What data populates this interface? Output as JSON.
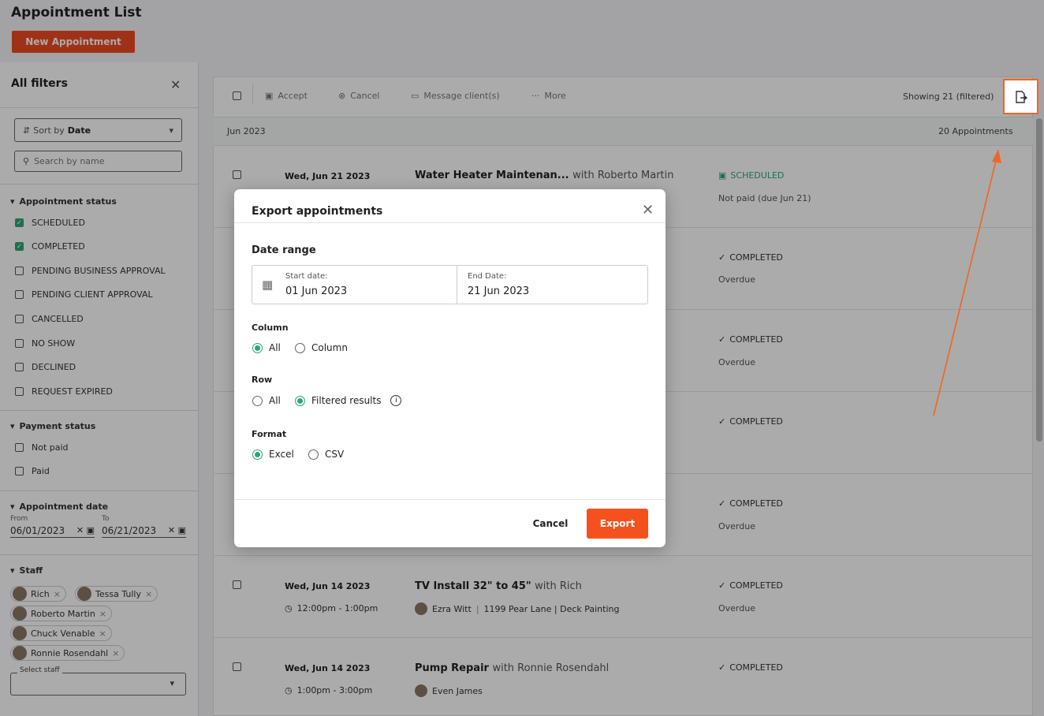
{
  "header": {
    "title": "Appointment List",
    "new_button": "New Appointment"
  },
  "sidebar": {
    "title": "All filters",
    "sort": {
      "prefix": "Sort by",
      "value": "Date"
    },
    "search_placeholder": "Search by name",
    "appointment_status": {
      "title": "Appointment status",
      "items": [
        {
          "label": "SCHEDULED",
          "checked": true
        },
        {
          "label": "COMPLETED",
          "checked": true
        },
        {
          "label": "PENDING BUSINESS APPROVAL",
          "checked": false
        },
        {
          "label": "PENDING CLIENT APPROVAL",
          "checked": false
        },
        {
          "label": "CANCELLED",
          "checked": false
        },
        {
          "label": "NO SHOW",
          "checked": false
        },
        {
          "label": "DECLINED",
          "checked": false
        },
        {
          "label": "REQUEST EXPIRED",
          "checked": false
        }
      ]
    },
    "payment_status": {
      "title": "Payment status",
      "items": [
        {
          "label": "Not paid",
          "checked": false
        },
        {
          "label": "Paid",
          "checked": false
        }
      ]
    },
    "appointment_date": {
      "title": "Appointment date",
      "from_label": "From",
      "from": "06/01/2023",
      "to_label": "To",
      "to": "06/21/2023"
    },
    "staff": {
      "title": "Staff",
      "chips": [
        "Rich",
        "Tessa Tully",
        "Roberto Martin",
        "Chuck Venable",
        "Ronnie Rosendahl"
      ],
      "select_label": "Select staff"
    }
  },
  "toolbar": {
    "accept": "Accept",
    "cancel": "Cancel",
    "message": "Message client(s)",
    "more": "More",
    "showing": "Showing 21 (filtered)"
  },
  "month": {
    "label": "Jun 2023",
    "count": "20 Appointments"
  },
  "rows": [
    {
      "date": "Wed, Jun 21 2023",
      "time": "",
      "title": "Water Heater Maintenan...",
      "with": "with Roberto Martin",
      "client": "",
      "address": "",
      "status": "SCHEDULED",
      "sub": "Not paid (due Jun 21)"
    },
    {
      "date": "",
      "time": "",
      "title": "",
      "with": "",
      "client": "",
      "address": "",
      "status": "COMPLETED",
      "sub": "Overdue"
    },
    {
      "date": "",
      "time": "",
      "title": "",
      "with": "",
      "client": "",
      "address": "",
      "status": "COMPLETED",
      "sub": "Overdue"
    },
    {
      "date": "",
      "time": "",
      "title": "",
      "with": "",
      "client": "",
      "address": "",
      "status": "COMPLETED",
      "sub": ""
    },
    {
      "date": "",
      "time": "",
      "title": "",
      "with": "",
      "client": "",
      "address": "",
      "status": "COMPLETED",
      "sub": "Overdue"
    },
    {
      "date": "Wed, Jun 14 2023",
      "time": "12:00pm - 1:00pm",
      "title": "TV Install 32\" to 45\"",
      "with": "with Rich",
      "client": "Ezra Witt",
      "address": "1199 Pear Lane | Deck Painting",
      "status": "COMPLETED",
      "sub": "Overdue"
    },
    {
      "date": "Wed, Jun 14 2023",
      "time": "1:00pm - 3:00pm",
      "title": "Pump Repair",
      "with": "with Ronnie Rosendahl",
      "client": "Even James",
      "address": "",
      "status": "COMPLETED",
      "sub": ""
    }
  ],
  "modal": {
    "title": "Export appointments",
    "date_range_label": "Date range",
    "start_label": "Start date:",
    "start_value": "01 Jun 2023",
    "end_label": "End Date:",
    "end_value": "21 Jun 2023",
    "column_label": "Column",
    "column_options": [
      "All",
      "Column"
    ],
    "column_selected": "All",
    "row_label": "Row",
    "row_options": [
      "All",
      "Filtered results"
    ],
    "row_selected": "Filtered results",
    "format_label": "Format",
    "format_options": [
      "Excel",
      "CSV"
    ],
    "format_selected": "Excel",
    "cancel": "Cancel",
    "export": "Export"
  },
  "colors": {
    "accent": "#f4511e",
    "green": "#2aa876",
    "highlight": "#f26522"
  },
  "icons": [
    "close-icon",
    "sort-icon",
    "chevron-down-icon",
    "search-icon",
    "calendar-icon",
    "clock-icon",
    "check-circle-icon",
    "export-file-icon",
    "info-icon",
    "message-icon"
  ]
}
